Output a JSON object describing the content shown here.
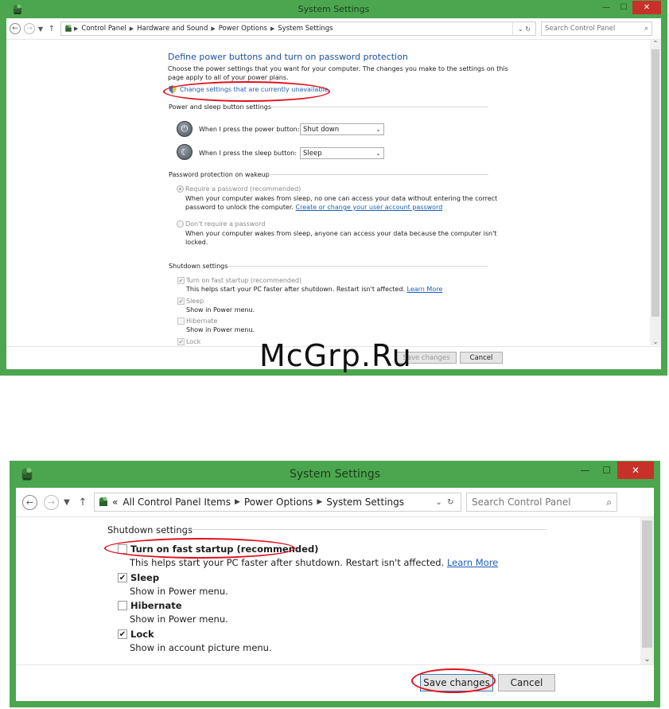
{
  "window1": {
    "title": "System Settings",
    "breadcrumbs": [
      "Control Panel",
      "Hardware and Sound",
      "Power Options",
      "System Settings"
    ],
    "search_placeholder": "Search Control Panel",
    "heading": "Define power buttons and turn on password protection",
    "intro_line1": "Choose the power settings that you want for your computer. The changes you make to the settings on this",
    "intro_line2": "page apply to all of your power plans.",
    "change_link": "Change settings that are currently unavailable",
    "power_section": "Power and sleep button settings",
    "power_label": "When I press the power button:",
    "power_value": "Shut down",
    "sleep_label": "When I press the sleep button:",
    "sleep_value": "Sleep",
    "password_section": "Password protection on wakeup",
    "require_label": "Require a password (recommended)",
    "require_desc1": "When your computer wakes from sleep, no one can access your data without entering the correct",
    "require_desc2": "password to unlock the computer.",
    "require_link": "Create or change your user account password",
    "norequire_label": "Don't require a password",
    "norequire_desc1": "When your computer wakes from sleep, anyone can access your data because the computer isn't",
    "norequire_desc2": "locked.",
    "shutdown_section": "Shutdown settings",
    "fast_label": "Turn on fast startup (recommended)",
    "fast_desc": "This helps start your PC faster after shutdown. Restart isn't affected.",
    "learn_more": "Learn More",
    "sleep_cb_label": "Sleep",
    "sleep_cb_desc": "Show in Power menu.",
    "hibernate_label": "Hibernate",
    "hibernate_desc": "Show in Power menu.",
    "lock_label": "Lock",
    "save_label": "Save changes",
    "cancel_label": "Cancel"
  },
  "window2": {
    "title": "System Settings",
    "breadcrumb_prefix": "«",
    "breadcrumbs": [
      "All Control Panel Items",
      "Power Options",
      "System Settings"
    ],
    "search_placeholder": "Search Control Panel",
    "shutdown_section": "Shutdown settings",
    "fast_label": "Turn on fast startup (recommended)",
    "fast_desc": "This helps start your PC faster after shutdown. Restart isn't affected.",
    "learn_more": "Learn More",
    "sleep_label": "Sleep",
    "sleep_desc": "Show in Power menu.",
    "hibernate_label": "Hibernate",
    "hibernate_desc": "Show in Power menu.",
    "lock_label": "Lock",
    "lock_desc": "Show in account picture menu.",
    "save_label": "Save changes",
    "cancel_label": "Cancel"
  },
  "checkmark": "✔",
  "watermark": "McGrp.Ru",
  "colors": {
    "title_bar": "#4ca64f",
    "close": "#c7312a",
    "highlight": "#e2101e",
    "link": "#1c5fb8"
  }
}
